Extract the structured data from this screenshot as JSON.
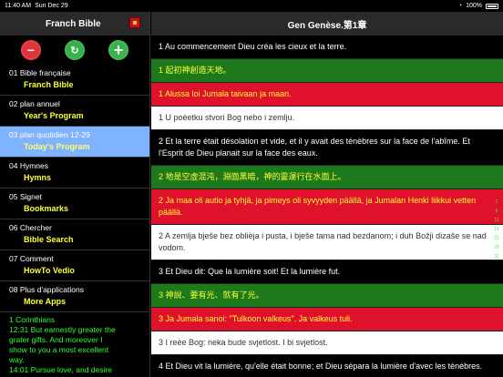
{
  "statusbar": {
    "time": "11:40 AM",
    "date": "Sun Dec 29",
    "wifi": "◔",
    "battery": "100%"
  },
  "sidebar": {
    "title": "Franch Bible",
    "actions": {
      "minus": "−",
      "refresh": "↻",
      "plus": "+"
    },
    "items": [
      {
        "line1": "01 Bible française",
        "line2": "Franch Bible"
      },
      {
        "line1": "02 plan annuel",
        "line2": "Year's Program"
      },
      {
        "line1": "03 plan quotidien  12-29",
        "line2": "Today's Program"
      },
      {
        "line1": "04 Hymnes",
        "line2": "Hymns"
      },
      {
        "line1": "05 Signet",
        "line2": "Bookmarks"
      },
      {
        "line1": "06 Chercher",
        "line2": "Bible Search"
      },
      {
        "line1": "07 Comment",
        "line2": "HowTo Vedio"
      },
      {
        "line1": "08 Plus d'applications",
        "line2": "More Apps"
      }
    ],
    "verse_box": [
      "1 Corinthians",
      "12:31 But earnestly greater the",
      "grater gifts. And moreover I",
      "show to you a most excellent",
      "way.",
      "14:01 Pursue love, and desire"
    ]
  },
  "main": {
    "title": "Gen Genèse.第1章",
    "verses": [
      {
        "style": "black",
        "text": "1 Au commencement Dieu créa les cieux et la terre."
      },
      {
        "style": "green",
        "text": "1 起初神創造天地。"
      },
      {
        "style": "red",
        "text": "1 Alussa loi Jumala taivaan ja maan."
      },
      {
        "style": "white",
        "text": "1 U poèetku stvori Bog nebo i zemlju."
      },
      {
        "style": "black",
        "text": "2 Et la terre était désolation et vide, et il y avait des ténèbres sur la face de l'abîme. Et l'Esprit de Dieu planait sur la face des eaux."
      },
      {
        "style": "green",
        "text": "2 地是空虛混沌，淵面黑暗，神的靈運行在水面上。"
      },
      {
        "style": "red",
        "text": "2 Ja maa oli autio ja tyhjä, ja pimeys oli syvyyden päällä, ja Jumalan Henki liikkui vetten päällä."
      },
      {
        "style": "white",
        "text": "2 A zemlja bješe bez oblièja i pusta, i bješe tama nad bezdanom; i duh Božji dizaše se nad vodom."
      },
      {
        "style": "black",
        "text": "3 Et Dieu dit: Que la lumière soit! Et la lumière fut."
      },
      {
        "style": "green",
        "text": "3 神說、要有光、就有了光。"
      },
      {
        "style": "red",
        "text": "3 Ja Jumala sanoi: \"Tulkoon valkeus\". Ja valkeus tuli."
      },
      {
        "style": "white",
        "text": "3 I reèe Bog: neka bude svjetlost. I bi svjetlost."
      },
      {
        "style": "black",
        "text": "4 Et Dieu vit la lumière, qu'elle était bonne; et Dieu sépara la lumière d'avec les ténèbres."
      }
    ],
    "scroll_markers": [
      "1",
      "6",
      "11",
      "16",
      "21",
      "26",
      "31"
    ]
  },
  "colors": {
    "header": "#2a2a2a",
    "green": "#1c7a1c",
    "red": "#e0112b",
    "active": "#7fb3ff",
    "yellow": "#ffff33"
  }
}
